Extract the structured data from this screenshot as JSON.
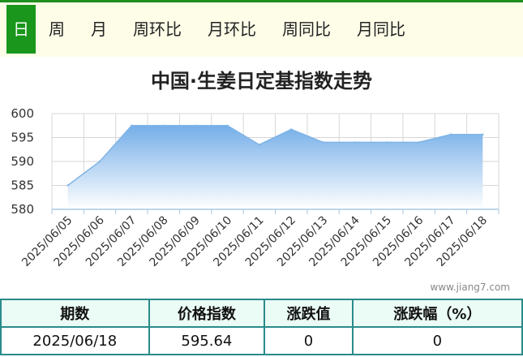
{
  "tabs": [
    {
      "label": "日",
      "active": true
    },
    {
      "label": "周"
    },
    {
      "label": "月"
    },
    {
      "label": "周环比"
    },
    {
      "label": "月环比"
    },
    {
      "label": "周同比"
    },
    {
      "label": "月同比"
    }
  ],
  "title": "中国·生姜日定基指数走势",
  "watermark": "www.jiang7.com",
  "chart_data": {
    "type": "area",
    "x": [
      "2025/06/05",
      "2025/06/06",
      "2025/06/07",
      "2025/06/08",
      "2025/06/09",
      "2025/06/10",
      "2025/06/11",
      "2025/06/12",
      "2025/06/13",
      "2025/06/14",
      "2025/06/15",
      "2025/06/16",
      "2025/06/17",
      "2025/06/18"
    ],
    "values": [
      585.0,
      590.0,
      597.5,
      597.5,
      597.5,
      597.5,
      593.5,
      596.7,
      594.0,
      594.0,
      594.0,
      594.0,
      595.64,
      595.64
    ],
    "ylim": [
      580,
      600
    ],
    "yticks": [
      580,
      585,
      590,
      595,
      600
    ],
    "grid": true,
    "colors": {
      "line": "#7fb4e6",
      "fill_top": "#74aee8",
      "fill_bottom": "#ffffff"
    }
  },
  "table": {
    "headers": [
      "期数",
      "价格指数",
      "涨跌值",
      "涨跌幅（%）"
    ],
    "row": [
      "2025/06/18",
      "595.64",
      "0",
      "0"
    ]
  }
}
